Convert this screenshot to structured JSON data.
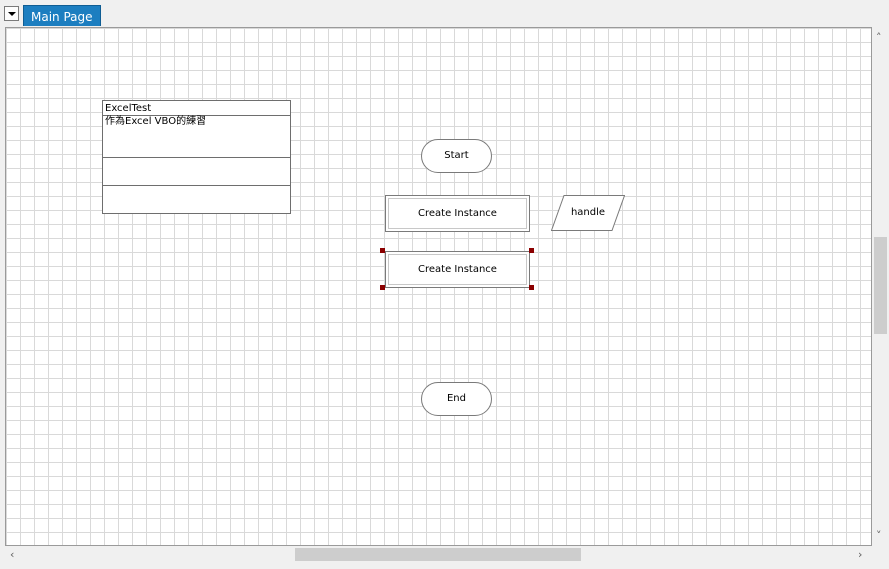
{
  "tabs": [
    {
      "label": "Main Page",
      "active": true
    }
  ],
  "colors": {
    "tab_active": "#1c7ec0",
    "selection_handle": "#8b0000",
    "grid": "#d9d9d9"
  },
  "icons": {
    "tab_menu": "dropdown-arrow-icon"
  },
  "note": {
    "title": "ExcelTest",
    "description": "作為Excel VBO的練習"
  },
  "flow": {
    "start": "Start",
    "action1": "Create Instance",
    "data_item": "handle",
    "action2": "Create Instance",
    "end": "End"
  }
}
